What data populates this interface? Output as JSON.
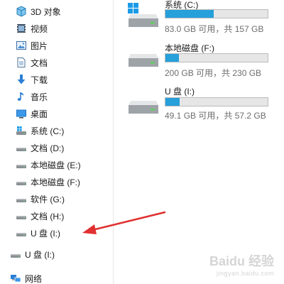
{
  "sidebar": {
    "items": [
      {
        "label": "3D 对象",
        "icon": "3d-objects-icon"
      },
      {
        "label": "视频",
        "icon": "video-icon"
      },
      {
        "label": "图片",
        "icon": "pictures-icon"
      },
      {
        "label": "文档",
        "icon": "documents-icon"
      },
      {
        "label": "下载",
        "icon": "download-icon"
      },
      {
        "label": "音乐",
        "icon": "music-icon"
      },
      {
        "label": "桌面",
        "icon": "desktop-icon"
      },
      {
        "label": "系统 (C:)",
        "icon": "system-drive-icon"
      },
      {
        "label": "文档 (D:)",
        "icon": "drive-icon"
      },
      {
        "label": "本地磁盘 (E:)",
        "icon": "drive-icon"
      },
      {
        "label": "本地磁盘 (F:)",
        "icon": "drive-icon"
      },
      {
        "label": "软件 (G:)",
        "icon": "drive-icon"
      },
      {
        "label": "文档 (H:)",
        "icon": "drive-icon"
      },
      {
        "label": "U 盘 (I:)",
        "icon": "usb-drive-icon"
      }
    ],
    "usb_root": {
      "label": "U 盘 (I:)",
      "icon": "usb-drive-icon"
    },
    "network": {
      "label": "网络",
      "icon": "network-icon"
    }
  },
  "drives": [
    {
      "name": "系统 (C:)",
      "size_text": "83.0 GB 可用，共 157 GB",
      "used_fraction": 0.47,
      "icon": "windows-drive-icon"
    },
    {
      "name": "本地磁盘 (F:)",
      "size_text": "200 GB 可用，共 230 GB",
      "used_fraction": 0.13,
      "icon": "hard-drive-icon"
    },
    {
      "name": "U 盘 (I:)",
      "size_text": "49.1 GB 可用，共 57.2 GB",
      "used_fraction": 0.14,
      "icon": "usb-drive-icon"
    }
  ],
  "colors": {
    "accent": "#26a0da",
    "arrow": "#e03030"
  },
  "watermark": {
    "text": "Baidu 经验",
    "sub": "jingyan.baidu.com"
  }
}
